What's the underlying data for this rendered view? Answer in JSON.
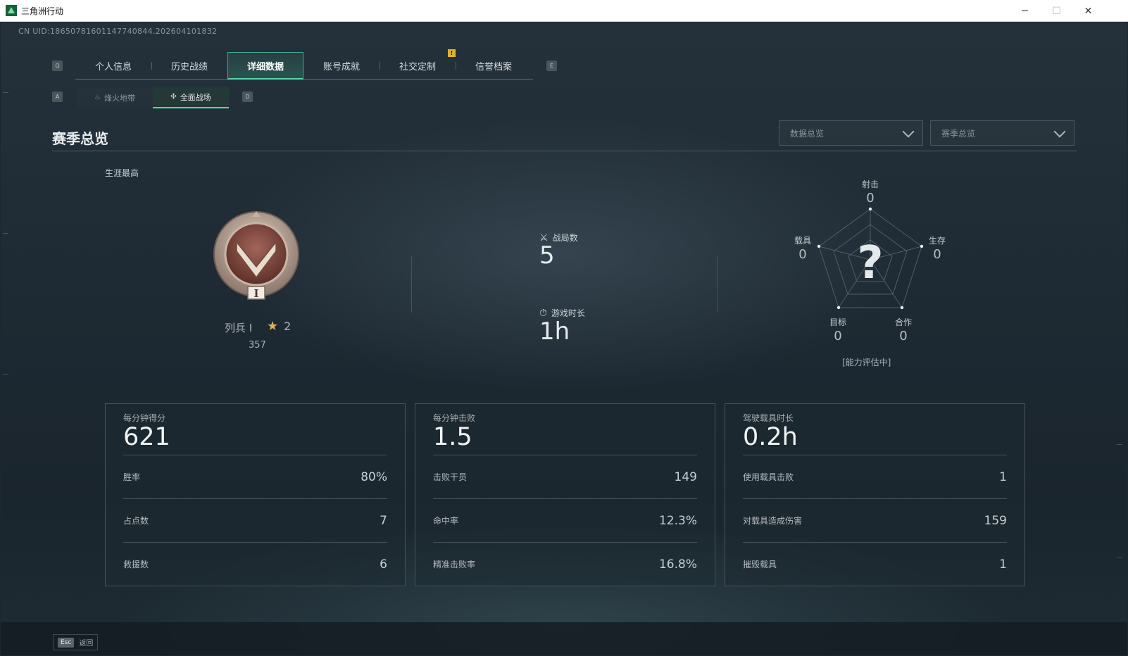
{
  "window": {
    "title": "三角洲行动",
    "minimize_glyph": "─",
    "maximize_glyph": "☐",
    "close_glyph": "✕"
  },
  "uid": "CN UID:18650781601147740844.202604101832",
  "key_hints": {
    "prev_tab": "Q",
    "next_tab": "E",
    "prev_sub": "A",
    "next_sub": "D"
  },
  "tabs": [
    {
      "label": "个人信息"
    },
    {
      "label": "历史战绩"
    },
    {
      "label": "详细数据"
    },
    {
      "label": "账号成就"
    },
    {
      "label": "社交定制"
    },
    {
      "label": "信誉档案"
    }
  ],
  "active_tab_index": 2,
  "tab_badge": "!",
  "subtabs": [
    {
      "label": "烽火地带",
      "icon": "flame-icon"
    },
    {
      "label": "全面战场",
      "icon": "crossed-rifles-icon"
    }
  ],
  "section": {
    "title": "赛季总览",
    "dropdown_data": "数据总览",
    "dropdown_season": "赛季总览",
    "career_label": "生涯最高"
  },
  "rank": {
    "name": "列兵 I",
    "medal_numeral": "I",
    "stars": "2",
    "score": "357"
  },
  "overview": {
    "matches_label": "战局数",
    "matches_value": "5",
    "playtime_label": "游戏时长",
    "playtime_value": "1h"
  },
  "radar": {
    "center": "?",
    "note": "[能力评估中]",
    "axes": [
      {
        "label": "射击",
        "value": "0"
      },
      {
        "label": "生存",
        "value": "0"
      },
      {
        "label": "合作",
        "value": "0"
      },
      {
        "label": "目标",
        "value": "0"
      },
      {
        "label": "载具",
        "value": "0"
      }
    ]
  },
  "cards": [
    {
      "label": "每分钟得分",
      "value": "621",
      "rows": [
        {
          "label": "胜率",
          "value": "80%"
        },
        {
          "label": "占点数",
          "value": "7"
        },
        {
          "label": "救援数",
          "value": "6"
        }
      ]
    },
    {
      "label": "每分钟击败",
      "value": "1.5",
      "rows": [
        {
          "label": "击败干员",
          "value": "149"
        },
        {
          "label": "命中率",
          "value": "12.3%"
        },
        {
          "label": "精准击败率",
          "value": "16.8%"
        }
      ]
    },
    {
      "label": "驾驶载具时长",
      "value": "0.2h",
      "rows": [
        {
          "label": "使用载具击败",
          "value": "1"
        },
        {
          "label": "对载具造成伤害",
          "value": "159"
        },
        {
          "label": "摧毁载具",
          "value": "1"
        }
      ]
    }
  ],
  "footer": {
    "esc_key": "Esc",
    "back_label": "返回"
  },
  "colors": {
    "accent": "#55d9a3",
    "badge": "#e0b22e",
    "star": "#d9b25a"
  }
}
